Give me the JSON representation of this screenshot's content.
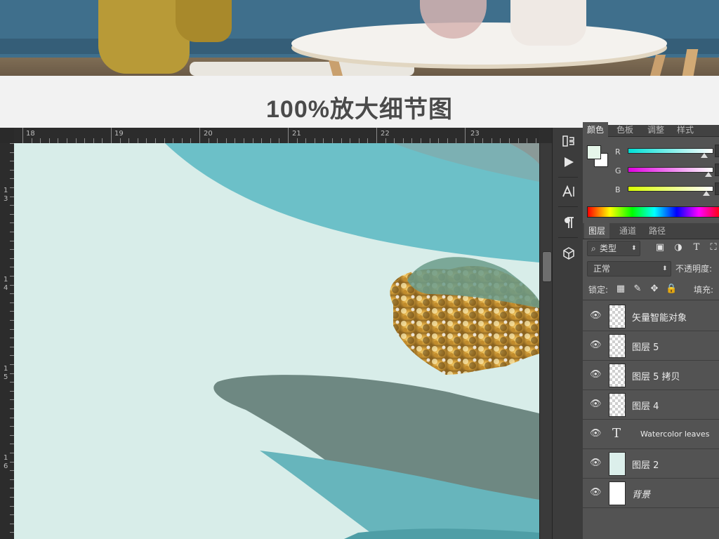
{
  "caption": "100%放大细节图",
  "ruler": {
    "top_marks": [
      "18",
      "19",
      "20",
      "21",
      "22",
      "23"
    ],
    "left_marks": [
      {
        "a": "1",
        "b": "3"
      },
      {
        "a": "1",
        "b": "4"
      },
      {
        "a": "1",
        "b": "5"
      },
      {
        "a": "1",
        "b": "6"
      }
    ]
  },
  "tool_icons": [
    "history-icon",
    "play-icon",
    "character-icon",
    "paragraph-icon",
    "3d-icon"
  ],
  "color_panel": {
    "tabs": [
      "颜色",
      "色板",
      "调整",
      "样式"
    ],
    "foreground_color": "#e6f6ea",
    "background_color": "#ffffff",
    "channels": [
      {
        "label": "R",
        "gradient": "linear-gradient(to right,#00e0d6,#ffffff)"
      },
      {
        "label": "G",
        "gradient": "linear-gradient(to right,#e000e0,#ffffff)"
      },
      {
        "label": "B",
        "gradient": "linear-gradient(to right,#d8ff00,#ffffff)"
      }
    ]
  },
  "layers_panel": {
    "tabs": [
      "图层",
      "通道",
      "路径"
    ],
    "filter_label": "类型",
    "blend_mode": "正常",
    "opacity_label": "不透明度:",
    "lock_label": "锁定:",
    "fill_label": "填充:",
    "layers": [
      {
        "name": "矢量智能对象",
        "thumb": "checker"
      },
      {
        "name": "图层 5",
        "thumb": "checker"
      },
      {
        "name": "图层 5 拷贝",
        "thumb": "checker"
      },
      {
        "name": "图层 4",
        "thumb": "checker"
      },
      {
        "name": "Watercolor leaves",
        "thumb": "text"
      },
      {
        "name": "图层 2",
        "thumb": "mint"
      },
      {
        "name": "背景",
        "thumb": "white"
      }
    ]
  }
}
